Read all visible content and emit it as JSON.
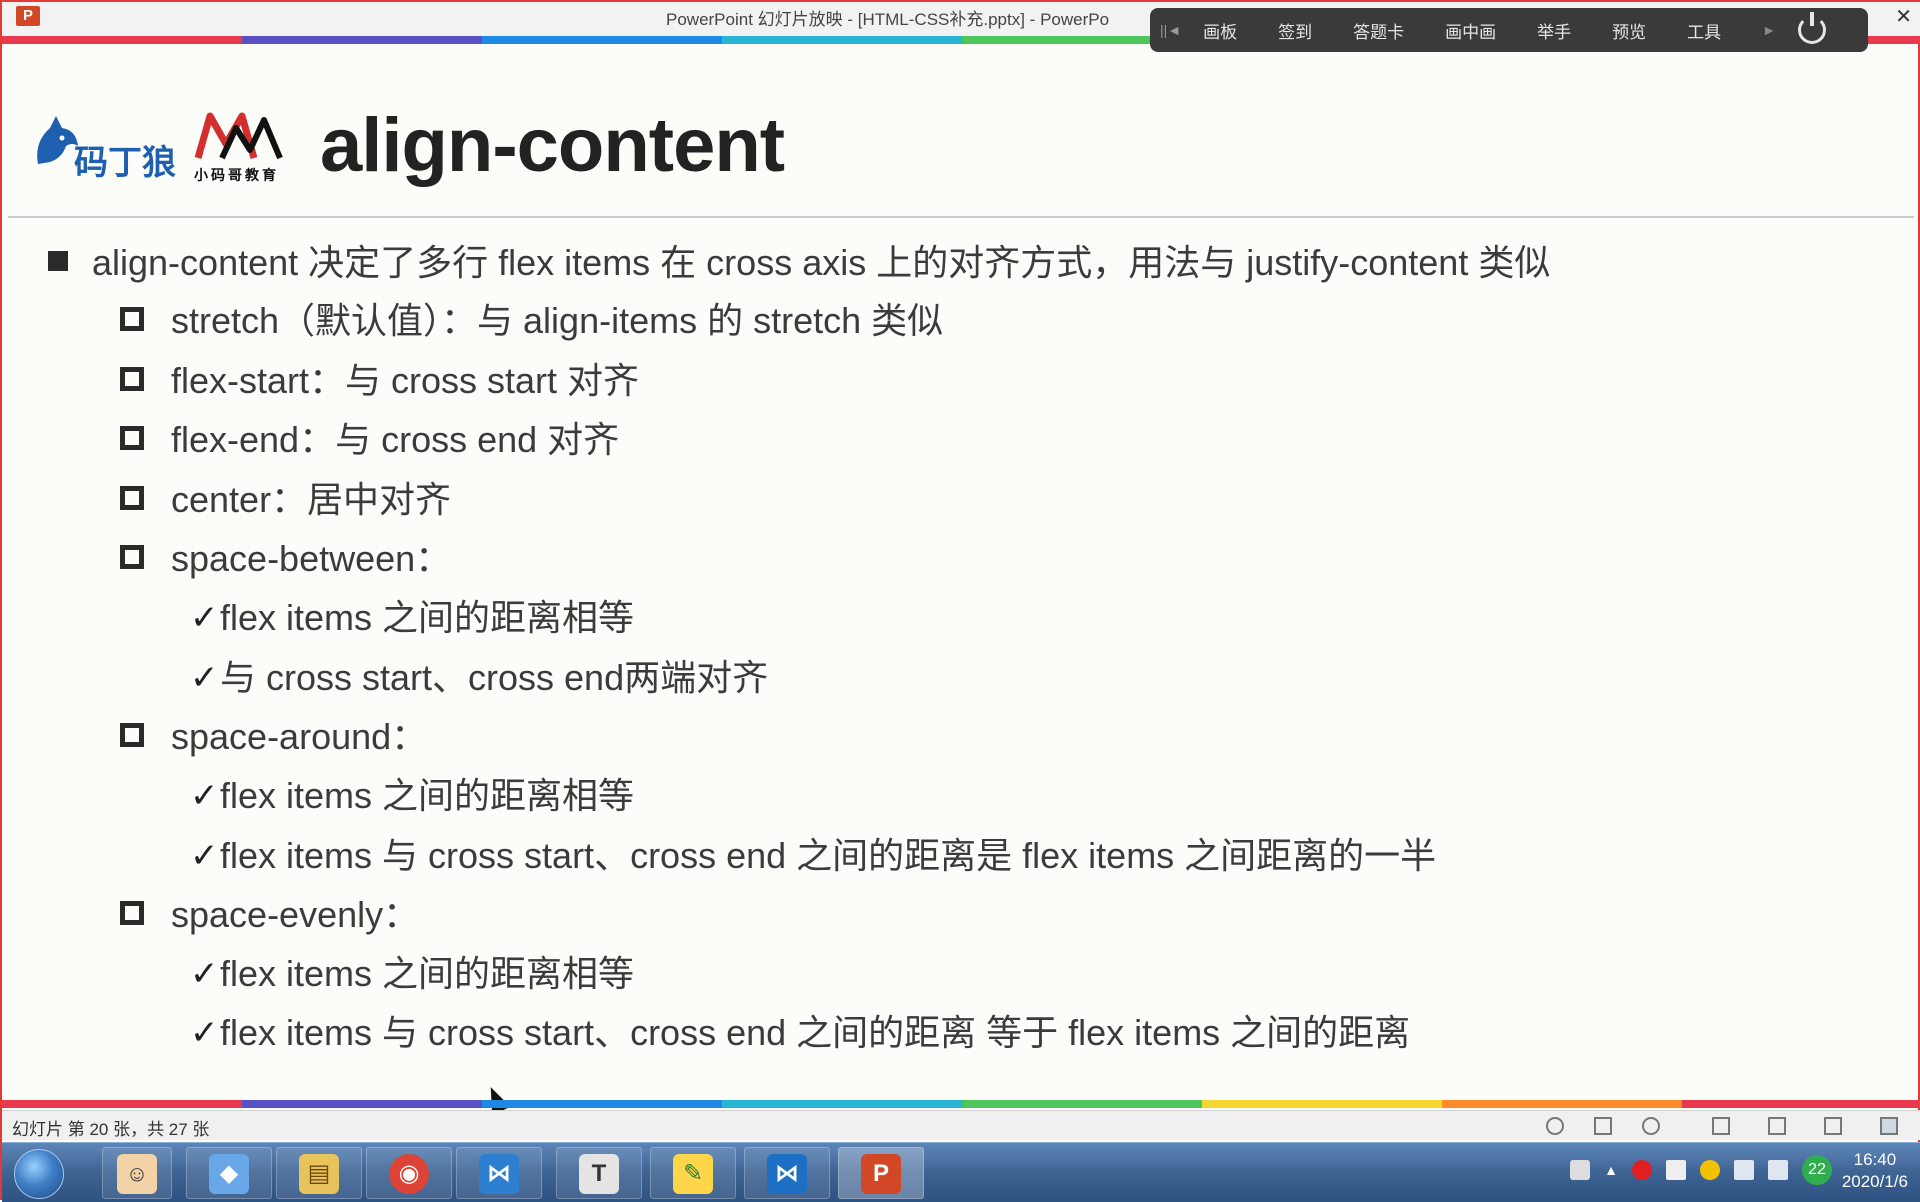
{
  "window": {
    "title": "PowerPoint 幻灯片放映 - [HTML-CSS补充.pptx] - PowerPo",
    "app_icon_letter": "P"
  },
  "float_toolbar": {
    "items": [
      "画板",
      "签到",
      "答题卡",
      "画中画",
      "举手",
      "预览",
      "工具"
    ],
    "power_icon": "power-icon"
  },
  "slide": {
    "title": "align-content",
    "logos": {
      "wolf_text": "码丁狼",
      "m_caption": "小码哥教育"
    },
    "bullets": [
      {
        "level": 1,
        "marker": "filled-square",
        "text": "align-content 决定了多行 flex items 在 cross axis 上的对齐方式，用法与 justify-content 类似"
      },
      {
        "level": 2,
        "marker": "hollow-square",
        "text": "stretch（默认值）：与 align-items 的 stretch 类似"
      },
      {
        "level": 2,
        "marker": "hollow-square",
        "text": "flex-start：与 cross start 对齐"
      },
      {
        "level": 2,
        "marker": "hollow-square",
        "text": "flex-end：与 cross end 对齐"
      },
      {
        "level": 2,
        "marker": "hollow-square",
        "text": "center：居中对齐"
      },
      {
        "level": 2,
        "marker": "hollow-square",
        "text": "space-between："
      },
      {
        "level": 3,
        "marker": "check",
        "text": "flex items 之间的距离相等"
      },
      {
        "level": 3,
        "marker": "check",
        "text": "与 cross start、cross end两端对齐"
      },
      {
        "level": 2,
        "marker": "hollow-square",
        "text": "space-around："
      },
      {
        "level": 3,
        "marker": "check",
        "text": "flex items 之间的距离相等"
      },
      {
        "level": 3,
        "marker": "check",
        "text": "flex items 与 cross start、cross end 之间的距离是 flex items 之间距离的一半"
      },
      {
        "level": 2,
        "marker": "hollow-square",
        "text": "space-evenly："
      },
      {
        "level": 3,
        "marker": "check",
        "text": "flex items 之间的距离相等"
      },
      {
        "level": 3,
        "marker": "check",
        "text": "flex items 与 cross start、cross end 之间的距离 等于 flex items 之间的距离"
      }
    ]
  },
  "statusbar": {
    "slide_counter": "幻灯片 第 20 张，共 27 张"
  },
  "taskbar": {
    "apps": [
      {
        "name": "3d-cube-icon",
        "glyph": "◆",
        "color": "#6aa7e8"
      },
      {
        "name": "file-explorer-icon",
        "glyph": "▤",
        "color": "#e8c25a"
      },
      {
        "name": "chrome-icon",
        "glyph": "◉",
        "color": "#db4437"
      },
      {
        "name": "vscode-icon",
        "glyph": "⋈",
        "color": "#2f7fd1"
      },
      {
        "name": "typora-icon",
        "glyph": "T",
        "color": "#d6d6d6"
      },
      {
        "name": "notepad-icon",
        "glyph": "✎",
        "color": "#ffd54a"
      },
      {
        "name": "vscode-icon-2",
        "glyph": "⋈",
        "color": "#1d6fc4"
      },
      {
        "name": "powerpoint-icon",
        "glyph": "P",
        "color": "#d24726"
      }
    ],
    "tray_badge": "22",
    "time": "16:40",
    "date": "2020/1/6"
  }
}
